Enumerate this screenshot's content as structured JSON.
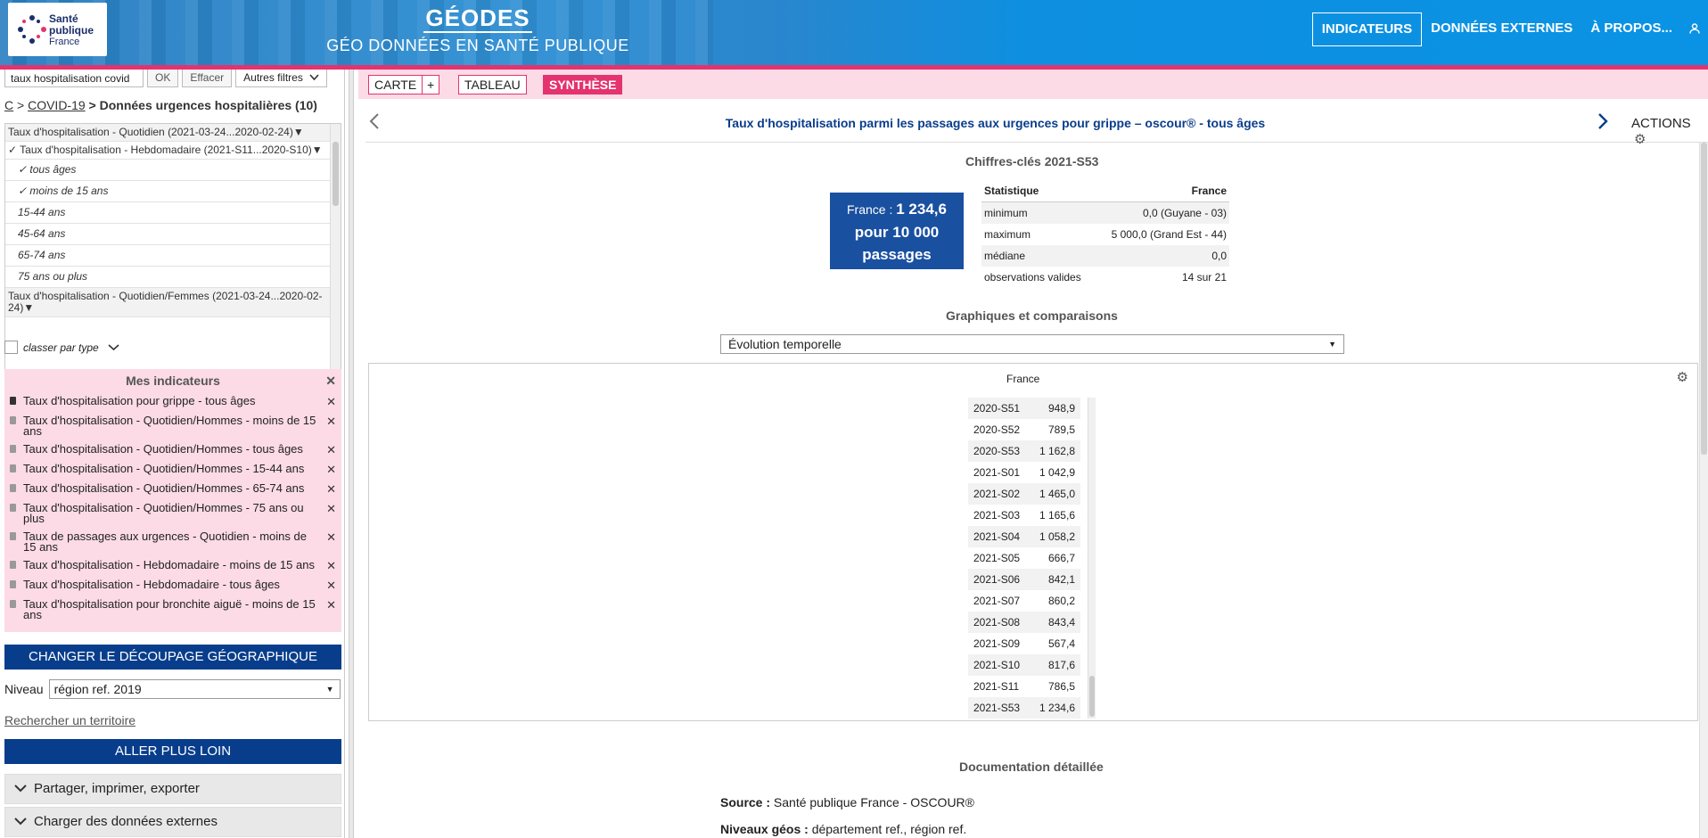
{
  "header": {
    "logo": {
      "line1": "Santé",
      "line2": "publique",
      "line3": "France"
    },
    "brand_title": "GÉODES",
    "brand_subtitle": "GÉO DONNÉES EN SANTÉ PUBLIQUE",
    "nav": [
      {
        "label": "INDICATEURS",
        "active": true
      },
      {
        "label": "DONNÉES EXTERNES",
        "active": false
      },
      {
        "label": "À PROPOS...",
        "active": false
      }
    ],
    "user_icon": "user-icon"
  },
  "sidebar": {
    "search": {
      "value": "taux hospitalisation covid",
      "ok": "OK",
      "clear": "Effacer",
      "filters": "Autres filtres"
    },
    "breadcrumb": {
      "root": "C",
      "sep1": " > ",
      "link": "COVID-19",
      "current": " > Données urgences hospitalières (10)"
    },
    "indicators": [
      {
        "label": "Taux d'hospitalisation - Quotidien (2021-03-24...2020-02-24)▼",
        "type": "grp"
      },
      {
        "label": "✓ Taux d'hospitalisation - Hebdomadaire (2021-S11...2020-S10)▼",
        "type": "open"
      },
      {
        "label": "✓ tous âges",
        "type": "sub"
      },
      {
        "label": "✓ moins de 15 ans",
        "type": "sub"
      },
      {
        "label": "15-44 ans",
        "type": "sub"
      },
      {
        "label": "45-64 ans",
        "type": "sub"
      },
      {
        "label": "65-74 ans",
        "type": "sub"
      },
      {
        "label": "75 ans ou plus",
        "type": "sub"
      },
      {
        "label": "Taux d'hospitalisation - Quotidien/Femmes (2021-03-24...2020-02-24)▼",
        "type": "grp"
      }
    ],
    "classer": "classer par type",
    "mes_indicateurs": {
      "title": "Mes indicateurs",
      "items": [
        "Taux d'hospitalisation pour grippe - tous âges",
        "Taux d'hospitalisation - Quotidien/Hommes - moins de 15 ans",
        "Taux d'hospitalisation - Quotidien/Hommes - tous âges",
        "Taux d'hospitalisation - Quotidien/Hommes - 15-44 ans",
        "Taux d'hospitalisation - Quotidien/Hommes - 65-74 ans",
        "Taux d'hospitalisation - Quotidien/Hommes - 75 ans ou plus",
        "Taux de passages aux urgences - Quotidien - moins de 15 ans",
        "Taux d'hospitalisation - Hebdomadaire - moins de 15 ans",
        "Taux d'hospitalisation - Hebdomadaire - tous âges",
        "Taux d'hospitalisation pour bronchite aiguë - moins de 15 ans"
      ]
    },
    "change_geo": "CHANGER LE DÉCOUPAGE GÉOGRAPHIQUE",
    "niveau_label": "Niveau",
    "niveau_value": "région ref. 2019",
    "rechercher": "Rechercher un territoire",
    "aller_plus_loin": "ALLER PLUS LOIN",
    "accordions": [
      "Partager, imprimer, exporter",
      "Charger des données externes"
    ]
  },
  "tabs": {
    "carte": "CARTE",
    "plus": "+",
    "tableau": "TABLEAU",
    "synthese": "SYNTHÈSE"
  },
  "main": {
    "title": "Taux d'hospitalisation parmi les passages aux urgences pour grippe – oscour® - tous âges",
    "actions": "ACTIONS",
    "key_figures_title": "Chiffres-clés 2021-S53",
    "kpi": {
      "prefix": "France : ",
      "value": "1 234,6",
      "line2": "pour 10 000",
      "line3": "passages"
    },
    "stats_header": {
      "col1": "Statistique",
      "col2": "France"
    },
    "stats": [
      {
        "label": "minimum",
        "value": "0,0 (Guyane - 03)"
      },
      {
        "label": "maximum",
        "value": "5 000,0 (Grand Est - 44)"
      },
      {
        "label": "médiane",
        "value": "0,0"
      },
      {
        "label": "observations valides",
        "value": "14 sur 21"
      }
    ],
    "graphs_title": "Graphiques et comparaisons",
    "graph_select": "Évolution temporelle",
    "table_caption": "France",
    "series": [
      {
        "week": "2020-S51",
        "value": "948,9"
      },
      {
        "week": "2020-S52",
        "value": "789,5"
      },
      {
        "week": "2020-S53",
        "value": "1 162,8"
      },
      {
        "week": "2021-S01",
        "value": "1 042,9"
      },
      {
        "week": "2021-S02",
        "value": "1 465,0"
      },
      {
        "week": "2021-S03",
        "value": "1 165,6"
      },
      {
        "week": "2021-S04",
        "value": "1 058,2"
      },
      {
        "week": "2021-S05",
        "value": "666,7"
      },
      {
        "week": "2021-S06",
        "value": "842,1"
      },
      {
        "week": "2021-S07",
        "value": "860,2"
      },
      {
        "week": "2021-S08",
        "value": "843,4"
      },
      {
        "week": "2021-S09",
        "value": "567,4"
      },
      {
        "week": "2021-S10",
        "value": "817,6"
      },
      {
        "week": "2021-S11",
        "value": "786,5"
      },
      {
        "week": "2021-S53",
        "value": "1 234,6"
      }
    ],
    "doc_title": "Documentation détaillée",
    "source_label": "Source : ",
    "source_value": "Santé publique France - OSCOUR®",
    "niveaux_label": "Niveaux géos : ",
    "niveaux_value": "département ref., région ref."
  },
  "colors": {
    "accent": "#e4336f",
    "navy": "#083d8c",
    "pink_bg": "#fcdbe6"
  }
}
